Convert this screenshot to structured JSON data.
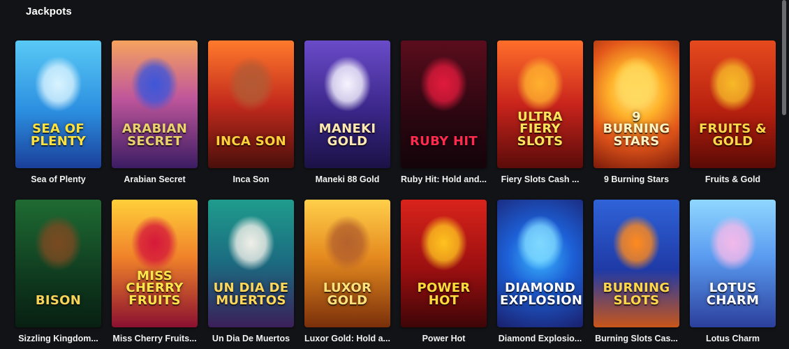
{
  "section": {
    "title": "Jackpots"
  },
  "games": [
    {
      "name": "Sea of Plenty",
      "logo": "Sea of Plenty",
      "bg": "linear-gradient(180deg,#59c9f5 0%,#2c8fe0 55%,#1a3f9a 100%)",
      "logo_color": "#ffe23a",
      "art_color": "#d8f3ff"
    },
    {
      "name": "Arabian Secret",
      "logo": "Arabian Secret",
      "bg": "linear-gradient(180deg,#f5a35e 0%,#c0569b 45%,#3b1c63 100%)",
      "logo_color": "#e9d36a",
      "art_color": "#3f56d8"
    },
    {
      "name": "Inca Son",
      "logo": "Inca Son",
      "bg": "linear-gradient(180deg,#ff7a2c 0%,#c32a1c 50%,#4a0f0b 100%)",
      "logo_color": "#ffd23a",
      "art_color": "#b35a34"
    },
    {
      "name": "Maneki 88 Gold",
      "logo": "Maneki Gold",
      "bg": "linear-gradient(180deg,#6a4bc9 0%,#3a2688 55%,#1b1246 100%)",
      "logo_color": "#ffe9b0",
      "art_color": "#f7f4ff"
    },
    {
      "name": "Ruby Hit: Hold and...",
      "logo": "Ruby Hit",
      "bg": "linear-gradient(180deg,#5a0d1c 0%,#2a0610 60%,#14040a 100%)",
      "logo_color": "#ff2b4f",
      "art_color": "#e01a3c"
    },
    {
      "name": "Fiery Slots Cash ...",
      "logo": "Ultra Fiery Slots",
      "bg": "linear-gradient(180deg,#ff6f2a 0%,#c9241c 50%,#5a0b09 100%)",
      "logo_color": "#ffe35a",
      "art_color": "#ffb02e"
    },
    {
      "name": "9 Burning Stars",
      "logo": "9 Burning Stars",
      "bg": "radial-gradient(circle at 50% 40%,#fff19a 0%,#ffb32b 30%,#e2561a 60%,#7a1a0a 100%)",
      "logo_color": "#fff3c4",
      "art_color": "#ffd85a"
    },
    {
      "name": "Fruits & Gold",
      "logo": "Fruits & Gold",
      "bg": "linear-gradient(180deg,#e54a1e 0%,#b7200f 55%,#5a0a05 100%)",
      "logo_color": "#ffd84a",
      "art_color": "#f7b928"
    },
    {
      "name": "Sizzling Kingdom...",
      "logo": "Bison",
      "bg": "linear-gradient(180deg,#1f6b33 0%,#0f3b1f 60%,#081f12 100%)",
      "logo_color": "#f7d35a",
      "art_color": "#7a4a22"
    },
    {
      "name": "Miss Cherry Fruits...",
      "logo": "Miss Cherry Fruits",
      "bg": "linear-gradient(180deg,#ffcf3a 0%,#f0822a 45%,#8a1030 100%)",
      "logo_color": "#ffe44a",
      "art_color": "#d6193a"
    },
    {
      "name": "Un Dia De Muertos",
      "logo": "Un Dia de Muertos",
      "bg": "linear-gradient(180deg,#1f9c8c 0%,#1b6a80 50%,#3b1f58 100%)",
      "logo_color": "#ffd85a",
      "art_color": "#f0efe8"
    },
    {
      "name": "Luxor Gold: Hold a...",
      "logo": "Luxor Gold",
      "bg": "linear-gradient(180deg,#ffcf4a 0%,#e58a1f 45%,#7a2f0a 100%)",
      "logo_color": "#ffe27a",
      "art_color": "#b5612c"
    },
    {
      "name": "Power Hot",
      "logo": "Power Hot",
      "bg": "linear-gradient(180deg,#d9231b 0%,#9a0f10 55%,#3e0507 100%)",
      "logo_color": "#ffdb3a",
      "art_color": "#ffc21e"
    },
    {
      "name": "Diamond Explosio...",
      "logo": "Diamond Explosion",
      "bg": "radial-gradient(circle at 50% 45%,#3bb7ff 0%,#1d5fd6 40%,#1a1f6b 100%)",
      "logo_color": "#ffffff",
      "art_color": "#7fd8ff"
    },
    {
      "name": "Burning Slots Cas...",
      "logo": "Burning Slots",
      "bg": "linear-gradient(180deg,#2f63d8 0%,#1f3aa6 55%,#c8561a 100%)",
      "logo_color": "#ffd84a",
      "art_color": "#ff8a1e"
    },
    {
      "name": "Lotus Charm",
      "logo": "Lotus Charm",
      "bg": "linear-gradient(180deg,#8fd7ff 0%,#5a9bf0 45%,#2b3f9c 100%)",
      "logo_color": "#ffffff",
      "art_color": "#f3b9ea"
    }
  ]
}
